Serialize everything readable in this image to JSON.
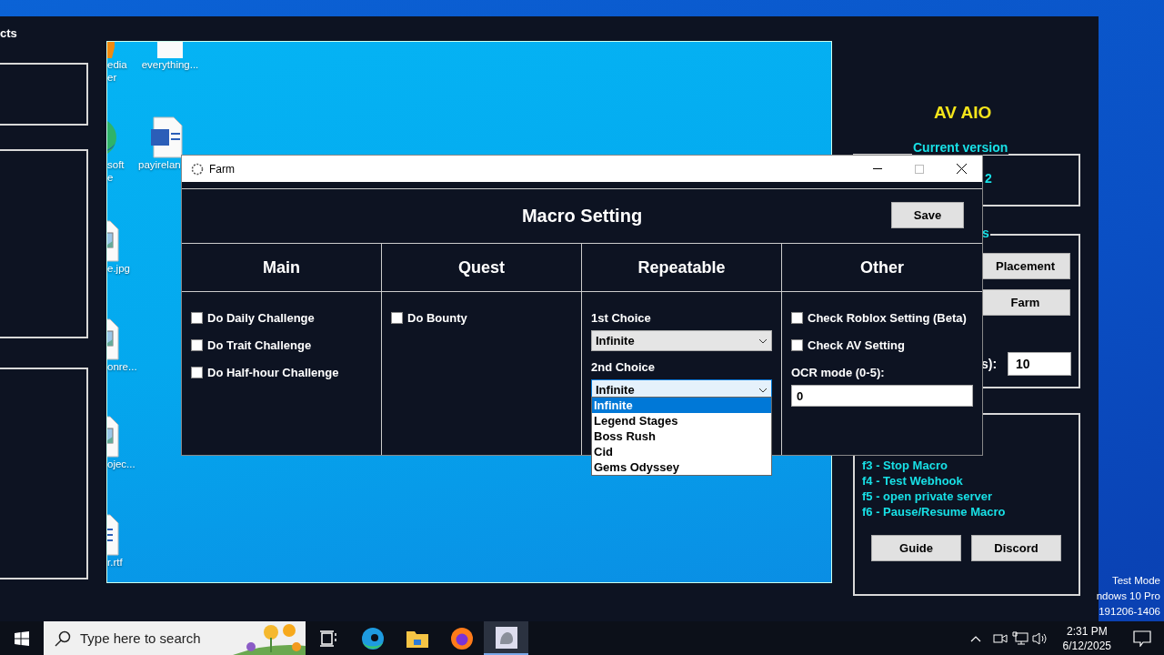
{
  "desktop": {
    "icons": [
      {
        "kind": "media",
        "lines": [
          "edia",
          "er"
        ]
      },
      {
        "kind": "blank",
        "lines": [
          "everything..."
        ]
      },
      {
        "kind": "edge",
        "lines": [
          "soft",
          "e"
        ]
      },
      {
        "kind": "word",
        "lines": [
          "payirelan"
        ]
      },
      {
        "kind": "image",
        "lines": [
          "e.jpg"
        ]
      },
      {
        "kind": "image",
        "lines": [
          "onre..."
        ]
      },
      {
        "kind": "image",
        "lines": [
          "ojec..."
        ]
      },
      {
        "kind": "text",
        "lines": [
          "r.rtf"
        ]
      }
    ],
    "system_info": [
      "Test Mode",
      "ndows 10 Pro",
      "191206-1406"
    ]
  },
  "main_window": {
    "title": "cts",
    "heading": "AV AIO",
    "version_group": {
      "label": "Current version",
      "value": "2"
    },
    "mode_group": {
      "label": "s",
      "buttons": [
        "Placement",
        "Farm"
      ],
      "field_label": "s):",
      "field_value": "10"
    },
    "hotkeys": [
      "f3 - Stop Macro",
      "f4 - Test Webhook",
      "f5 - open private server",
      "f6 - Pause/Resume Macro"
    ],
    "buttons": [
      "Guide",
      "Discord"
    ]
  },
  "farm_window": {
    "title": "Farm",
    "heading": "Macro Setting",
    "save": "Save",
    "columns": [
      {
        "title": "Main",
        "items": [
          {
            "kind": "checkbox",
            "label": "Do Daily Challenge",
            "checked": false
          },
          {
            "kind": "checkbox",
            "label": "Do Trait Challenge",
            "checked": false
          },
          {
            "kind": "checkbox",
            "label": "Do Half-hour Challenge",
            "checked": false
          }
        ]
      },
      {
        "title": "Quest",
        "items": [
          {
            "kind": "checkbox",
            "label": "Do Bounty",
            "checked": false
          }
        ]
      },
      {
        "title": "Repeatable",
        "items": [
          {
            "kind": "select",
            "label": "1st Choice",
            "value": "Infinite",
            "expanded": false
          },
          {
            "kind": "select",
            "label": "2nd Choice",
            "value": "Infinite",
            "expanded": true,
            "options": [
              {
                "label": "Infinite",
                "selected": true
              },
              {
                "label": "Legend Stages",
                "selected": false
              },
              {
                "label": "Boss Rush",
                "selected": false
              },
              {
                "label": "Cid",
                "selected": false
              },
              {
                "label": "Gems Odyssey",
                "selected": false
              }
            ]
          }
        ]
      },
      {
        "title": "Other",
        "items": [
          {
            "kind": "checkbox",
            "label": "Check Roblox Setting (Beta)",
            "checked": false
          },
          {
            "kind": "checkbox",
            "label": "Check AV Setting",
            "checked": false
          },
          {
            "kind": "field",
            "label": "OCR mode (0-5):",
            "value": "0"
          }
        ]
      }
    ]
  },
  "taskbar": {
    "search_placeholder": "Type here to search",
    "apps": [
      {
        "kind": "taskview",
        "selected": false
      },
      {
        "kind": "edge",
        "selected": false
      },
      {
        "kind": "folder",
        "selected": false
      },
      {
        "kind": "firefox",
        "selected": false
      },
      {
        "kind": "macro",
        "selected": true
      }
    ],
    "time": "2:31 PM",
    "date": "6/12/2025"
  }
}
